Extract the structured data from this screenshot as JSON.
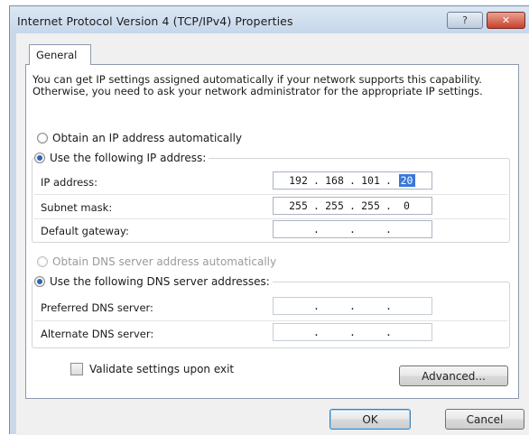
{
  "window": {
    "title": "Internet Protocol Version 4 (TCP/IPv4) Properties",
    "help_glyph": "?",
    "close_glyph": "✕"
  },
  "tabs": [
    {
      "label": "General",
      "selected": true
    }
  ],
  "intro_text": "You can get IP settings assigned automatically if your network supports this capability. Otherwise, you need to ask your network administrator for the appropriate IP settings.",
  "ip_mode": {
    "auto_label": "Obtain an IP address automatically",
    "manual_label": "Use the following IP address:",
    "selected": "manual"
  },
  "ip_fields": {
    "ip_address": {
      "label": "IP address:",
      "octets": [
        "192",
        "168",
        "101",
        "20"
      ]
    },
    "subnet_mask": {
      "label": "Subnet mask:",
      "octets": [
        "255",
        "255",
        "255",
        "0"
      ]
    },
    "default_gateway": {
      "label": "Default gateway:",
      "octets": [
        "",
        "",
        "",
        ""
      ]
    }
  },
  "dns_mode": {
    "auto_label": "Obtain DNS server address automatically",
    "manual_label": "Use the following DNS server addresses:",
    "selected": "manual"
  },
  "dns_fields": {
    "preferred": {
      "label": "Preferred DNS server:",
      "octets": [
        "",
        "",
        "",
        ""
      ]
    },
    "alternate": {
      "label": "Alternate DNS server:",
      "octets": [
        "",
        "",
        "",
        ""
      ]
    }
  },
  "validate": {
    "label": "Validate settings upon exit",
    "checked": false
  },
  "buttons": {
    "advanced": "Advanced...",
    "ok": "OK",
    "cancel": "Cancel"
  },
  "colors": {
    "titlebar": "#c6d7ea",
    "close_button": "#c8412c",
    "selection": "#3a78d8"
  }
}
